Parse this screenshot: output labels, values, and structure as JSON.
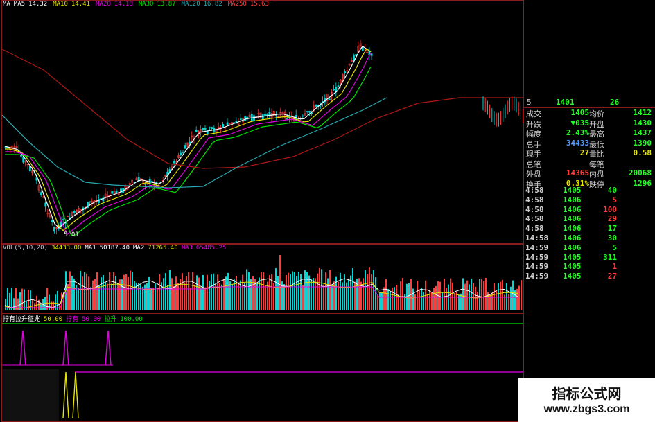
{
  "colors": {
    "background": "#000000",
    "border": "#8a1b1b",
    "up": "#ff3b3b",
    "down": "#00d7d7",
    "ma5": "#ffffff",
    "ma10": "#e6e600",
    "ma20": "#e600e6",
    "ma30": "#00e600",
    "ma120": "#2aa8b0",
    "ma250": "#b01818",
    "green_value": "#22ff22",
    "yellow_value": "#e6e600",
    "magenta": "#e600e6"
  },
  "price_legend": [
    {
      "label": "MA",
      "value": "",
      "color": "#ffffff"
    },
    {
      "label": "MA5",
      "value": "14.32",
      "color": "#ffffff"
    },
    {
      "label": "MA10",
      "value": "14.41",
      "color": "#e6e600"
    },
    {
      "label": "MA20",
      "value": "14.18",
      "color": "#e600e6"
    },
    {
      "label": "MA30",
      "value": "13.87",
      "color": "#00e600"
    },
    {
      "label": "MA120",
      "value": "16.82",
      "color": "#2aa8b0"
    },
    {
      "label": "MA250",
      "value": "15.63",
      "color": "#ff3b3b"
    }
  ],
  "price_low_label": "5.01",
  "vol_legend": [
    {
      "text": "VOL(5,10,20)",
      "color": "#c8c8c8"
    },
    {
      "text": "34433.00",
      "color": "#e6e600"
    },
    {
      "text": "MA1",
      "color": "#ffffff"
    },
    {
      "text": "50187.40",
      "color": "#ffffff"
    },
    {
      "text": "MA2",
      "color": "#ffffff"
    },
    {
      "text": "71265.40",
      "color": "#e6e600"
    },
    {
      "text": "MA3",
      "color": "#e600e6"
    },
    {
      "text": "65485.25",
      "color": "#e600e6"
    }
  ],
  "indicator_legend": [
    {
      "text": "拧有拉升征兆",
      "color": "#ffffff"
    },
    {
      "text": "50.00",
      "color": "#e6e600"
    },
    {
      "text": "拧有",
      "color": "#e600e6"
    },
    {
      "text": "50.00",
      "color": "#e600e6"
    },
    {
      "text": "拉升",
      "color": "#00e600"
    },
    {
      "text": "100.00",
      "color": "#00e600"
    }
  ],
  "quote_header": {
    "left": "5",
    "price": "1401",
    "right": "26"
  },
  "quote_rows": [
    {
      "l": "成交",
      "lv": "1405",
      "lc": "#22ff22",
      "r": "均价",
      "rv": "1412",
      "rc": "#22ff22"
    },
    {
      "l": "升跌",
      "lv": "▼035",
      "lc": "#22ff22",
      "r": "开盘",
      "rv": "1430",
      "rc": "#22ff22"
    },
    {
      "l": "幅度",
      "lv": "2.43%",
      "lc": "#22ff22",
      "r": "最高",
      "rv": "1437",
      "rc": "#22ff22"
    },
    {
      "l": "总手",
      "lv": "34433",
      "lc": "#5599ff",
      "r": "最低",
      "rv": "1390",
      "rc": "#22ff22"
    },
    {
      "l": "现手",
      "lv": "27",
      "lc": "#e6e600",
      "r": "量比",
      "rv": "0.58",
      "rc": "#e6e600"
    },
    {
      "l": "总笔",
      "lv": "",
      "lc": "#e6e600",
      "r": "每笔",
      "rv": "",
      "rc": "#e6e600"
    },
    {
      "l": "外盘",
      "lv": "14365",
      "lc": "#ff3b3b",
      "r": "内盘",
      "rv": "20068",
      "rc": "#22ff22"
    },
    {
      "l": "换手",
      "lv": "0.31%",
      "lc": "#e6e600",
      "r": "跌停",
      "rv": "1296",
      "rc": "#22ff22"
    }
  ],
  "ticks": [
    {
      "time": "4:58",
      "price": "1405",
      "vol": "40",
      "vc": "#22ff22"
    },
    {
      "time": "4:58",
      "price": "1406",
      "vol": "5",
      "vc": "#ff3b3b"
    },
    {
      "time": "4:58",
      "price": "1406",
      "vol": "100",
      "vc": "#ff3b3b"
    },
    {
      "time": "4:58",
      "price": "1406",
      "vol": "29",
      "vc": "#ff3b3b"
    },
    {
      "time": "4:58",
      "price": "1406",
      "vol": "17",
      "vc": "#22ff22"
    },
    {
      "time": "14:58",
      "price": "1406",
      "vol": "30",
      "vc": "#22ff22"
    },
    {
      "time": "14:59",
      "price": "1406",
      "vol": "5",
      "vc": "#22ff22"
    },
    {
      "time": "14:59",
      "price": "1405",
      "vol": "311",
      "vc": "#22ff22"
    },
    {
      "time": "14:59",
      "price": "1405",
      "vol": "1",
      "vc": "#ff3b3b"
    },
    {
      "time": "14:59",
      "price": "1405",
      "vol": "27",
      "vc": "#ff3b3b"
    }
  ],
  "watermark": {
    "cn": "指标公式网",
    "url": "www.zbgs3.com"
  }
}
